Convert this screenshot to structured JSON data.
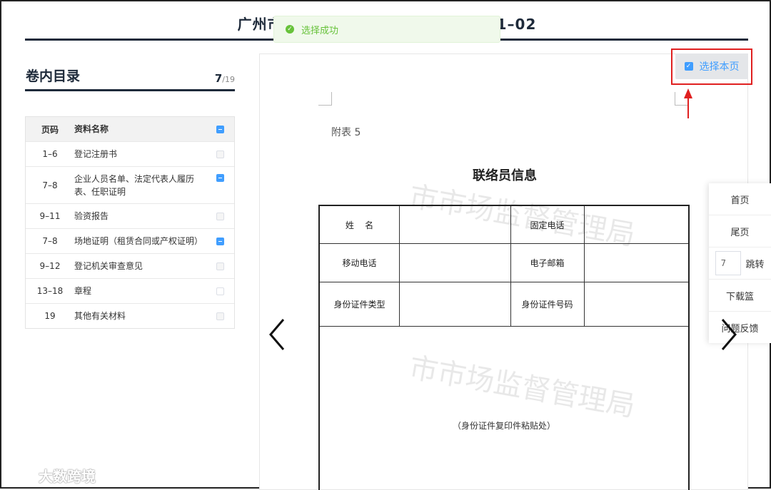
{
  "header": {
    "title_left": "广州市",
    "title_right": "1–02"
  },
  "toast": {
    "icon": "check-circle-icon",
    "message": "选择成功",
    "color": "#67c23a"
  },
  "sidebar": {
    "title": "卷内目录",
    "current_page": "7",
    "total_pages": "/19",
    "columns": {
      "page": "页码",
      "name": "资料名称"
    },
    "items": [
      {
        "page": "1–6",
        "name": "登记注册书",
        "state": "unchecked"
      },
      {
        "page": "7–8",
        "name": "企业人员名单、法定代表人履历表、任职证明",
        "state": "indeterminate"
      },
      {
        "page": "9–11",
        "name": "验资报告",
        "state": "unchecked"
      },
      {
        "page": "7–8",
        "name": "场地证明（租赁合同或产权证明）",
        "state": "indeterminate"
      },
      {
        "page": "9–12",
        "name": "登记机关审查意见",
        "state": "unchecked"
      },
      {
        "page": "13–18",
        "name": "章程",
        "state": "empty"
      },
      {
        "page": "19",
        "name": "其他有关材料",
        "state": "unchecked"
      }
    ]
  },
  "document": {
    "label": "附表 5",
    "title": "联络员信息",
    "watermark": "市市场监督管理局",
    "fields": {
      "name": "姓    名",
      "landline": "固定电话",
      "mobile": "移动电话",
      "email": "电子邮箱",
      "id_type": "身份证件类型",
      "id_number": "身份证件号码",
      "paste_note": "（身份证件复印件粘贴处）"
    }
  },
  "select_page": {
    "label": "选择本页",
    "accent": "#409eff",
    "highlight": "#e02020"
  },
  "right_panel": {
    "first": "首页",
    "last": "尾页",
    "jump_value": "7",
    "jump": "跳转",
    "download": "下载篮",
    "feedback": "问题反馈"
  },
  "brand": {
    "text": "大数跨境"
  }
}
